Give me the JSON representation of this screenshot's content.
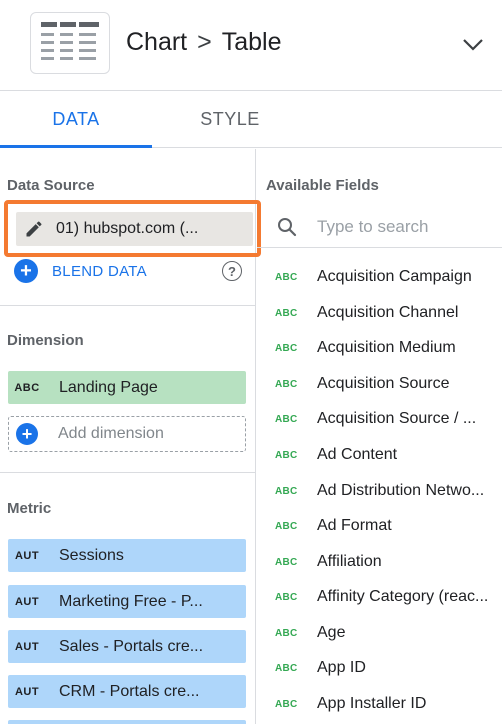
{
  "header": {
    "breadcrumb_chart": "Chart",
    "breadcrumb_sep": ">",
    "breadcrumb_table": "Table"
  },
  "tabs": [
    {
      "label": "DATA",
      "active": true
    },
    {
      "label": "STYLE",
      "active": false
    }
  ],
  "data_source": {
    "title": "Data Source",
    "name": "01) hubspot.com (...",
    "blend_label": "BLEND DATA",
    "help_glyph": "?"
  },
  "dimension": {
    "title": "Dimension",
    "chips": [
      {
        "type": "ABC",
        "label": "Landing Page"
      }
    ],
    "add_label": "Add dimension"
  },
  "metric": {
    "title": "Metric",
    "chips": [
      {
        "type": "AUT",
        "label": "Sessions"
      },
      {
        "type": "AUT",
        "label": "Marketing Free - P..."
      },
      {
        "type": "AUT",
        "label": "Sales - Portals cre..."
      },
      {
        "type": "AUT",
        "label": "CRM - Portals cre..."
      }
    ]
  },
  "available_fields": {
    "title": "Available Fields",
    "search_placeholder": "Type to search",
    "fields": [
      {
        "type": "ABC",
        "label": "Acquisition Campaign"
      },
      {
        "type": "ABC",
        "label": "Acquisition Channel"
      },
      {
        "type": "ABC",
        "label": "Acquisition Medium"
      },
      {
        "type": "ABC",
        "label": "Acquisition Source"
      },
      {
        "type": "ABC",
        "label": "Acquisition Source / ..."
      },
      {
        "type": "ABC",
        "label": "Ad Content"
      },
      {
        "type": "ABC",
        "label": "Ad Distribution Netwo..."
      },
      {
        "type": "ABC",
        "label": "Ad Format"
      },
      {
        "type": "ABC",
        "label": "Affiliation"
      },
      {
        "type": "ABC",
        "label": "Affinity Category (reac..."
      },
      {
        "type": "ABC",
        "label": "Age"
      },
      {
        "type": "ABC",
        "label": "App ID"
      },
      {
        "type": "ABC",
        "label": "App Installer ID"
      }
    ]
  },
  "colors": {
    "accent": "#1a73e8",
    "highlight": "#f47a31",
    "dimension_chip": "#b7e1c1",
    "metric_chip": "#aed6fa",
    "field_type": "#34a853"
  },
  "icons": {
    "chart_type": "table-chart-icon",
    "collapse": "chevron-down-icon",
    "edit": "pencil-icon",
    "add": "plus-circle-icon",
    "help": "help-circle-icon",
    "search": "search-icon"
  }
}
